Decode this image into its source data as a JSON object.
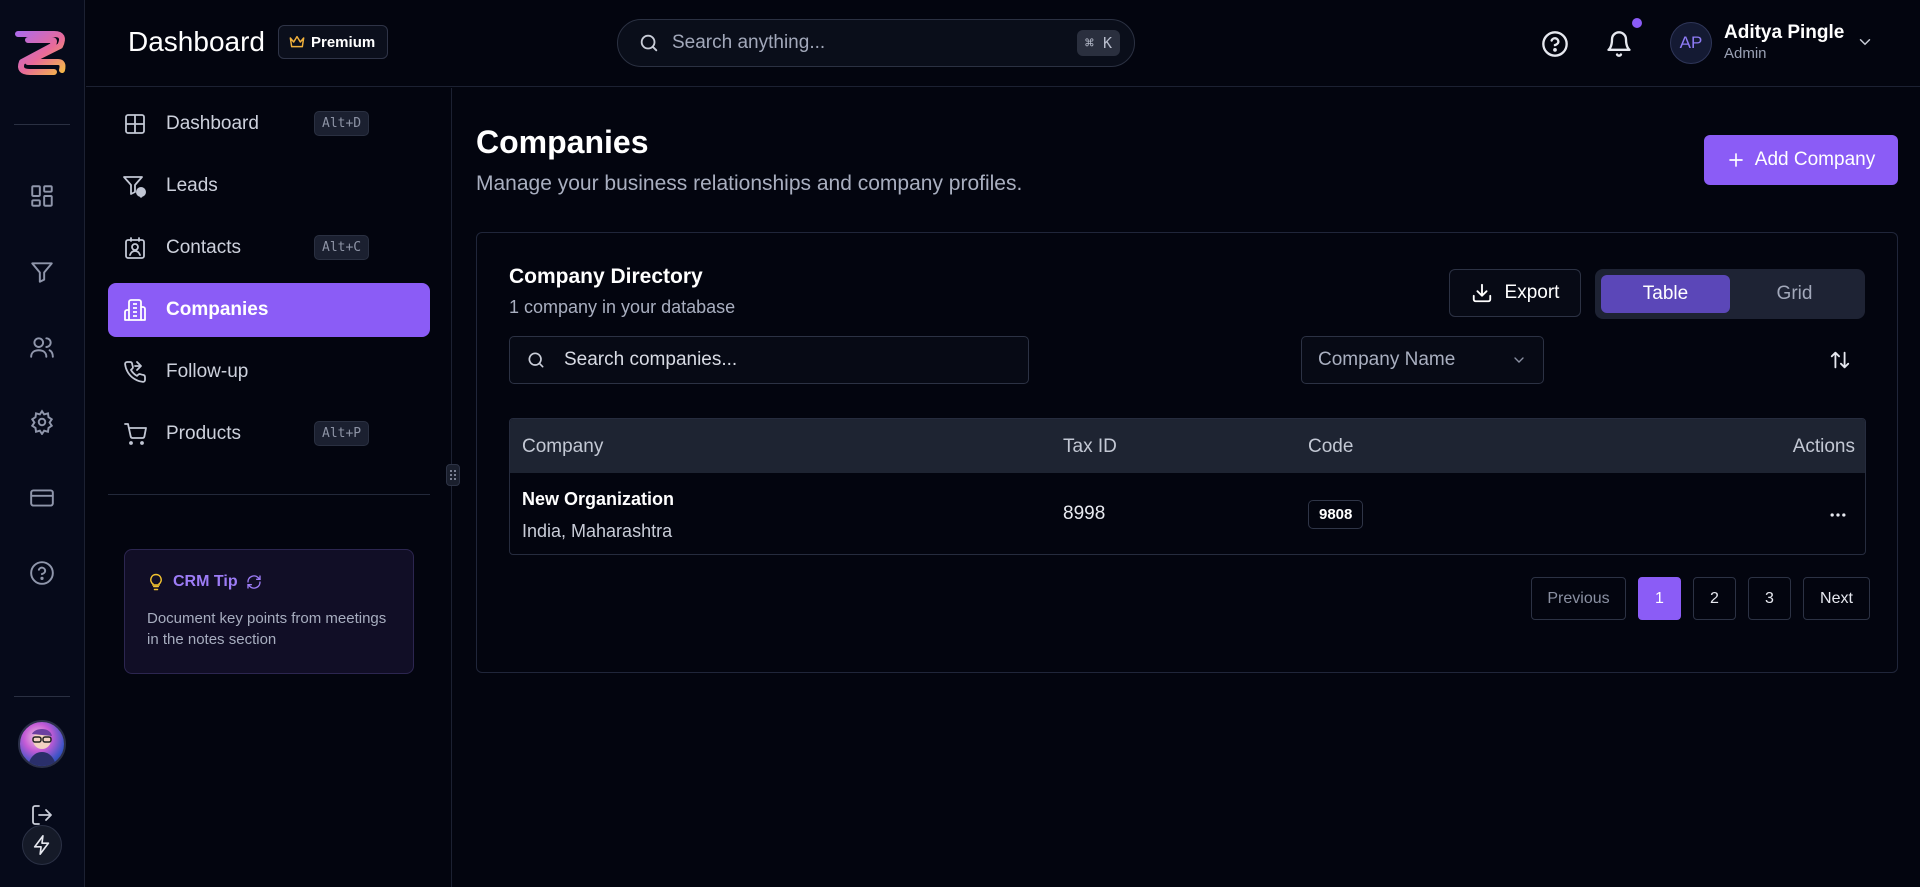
{
  "header": {
    "title": "Dashboard",
    "badge": "Premium",
    "search_placeholder": "Search anything...",
    "search_shortcut": "⌘ K",
    "user": {
      "initials": "AP",
      "name": "Aditya Pingle",
      "role": "Admin"
    }
  },
  "sidebar": {
    "items": [
      {
        "label": "Dashboard",
        "shortcut": "Alt+D"
      },
      {
        "label": "Leads",
        "shortcut": ""
      },
      {
        "label": "Contacts",
        "shortcut": "Alt+C"
      },
      {
        "label": "Companies",
        "shortcut": "",
        "active": true
      },
      {
        "label": "Follow-up",
        "shortcut": ""
      },
      {
        "label": "Products",
        "shortcut": "Alt+P"
      }
    ],
    "tip": {
      "title": "CRM Tip",
      "body": "Document key points from meetings in the notes section"
    }
  },
  "rail": {
    "icons": [
      "grid-icon",
      "filter-icon",
      "users-icon",
      "gear-icon",
      "card-icon",
      "help-icon",
      "logout-icon",
      "bolt-icon"
    ]
  },
  "main": {
    "title": "Companies",
    "subtitle": "Manage your business relationships and company profiles.",
    "add_label": "Add Company",
    "card": {
      "title": "Company Directory",
      "subtitle": "1 company in your database",
      "export_label": "Export",
      "views": [
        "Table",
        "Grid"
      ],
      "active_view": "Table",
      "search_placeholder": "Search companies...",
      "sort_selected": "Company Name"
    },
    "table": {
      "columns": [
        "Company",
        "Tax ID",
        "Code",
        "Actions"
      ],
      "rows": [
        {
          "name": "New Organization",
          "location": "India, Maharashtra",
          "tax_id": "8998",
          "code": "9808"
        }
      ]
    },
    "pagination": {
      "previous": "Previous",
      "pages": [
        "1",
        "2",
        "3"
      ],
      "current": "1",
      "next": "Next"
    }
  },
  "colors": {
    "accent": "#8b5cf6",
    "background": "#03050f",
    "rail": "#060a1a"
  }
}
